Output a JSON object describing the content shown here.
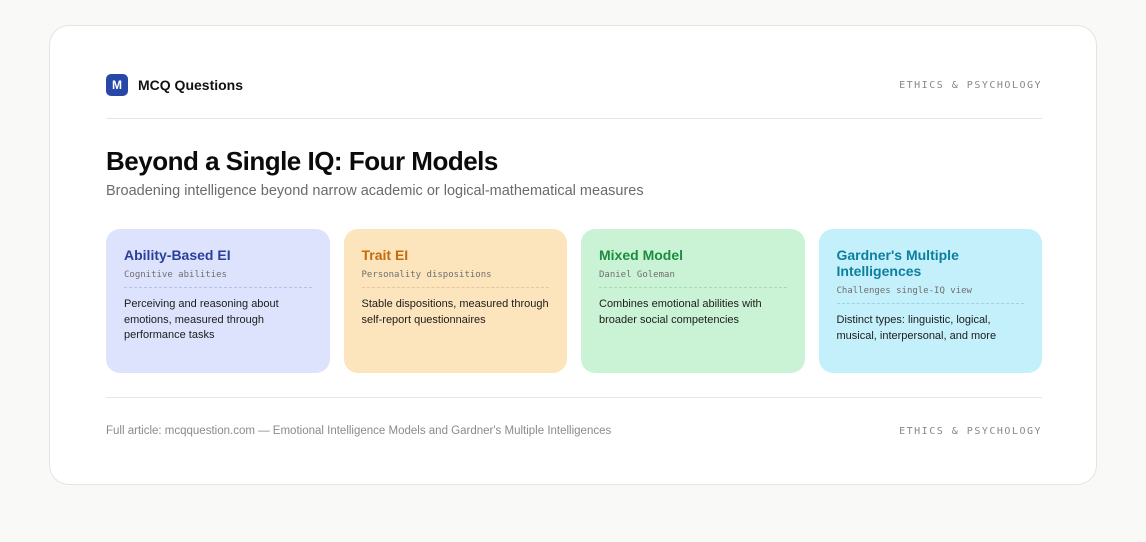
{
  "header": {
    "logo_letter": "M",
    "brand_name": "MCQ Questions",
    "category": "ETHICS & PSYCHOLOGY"
  },
  "page": {
    "title": "Beyond a Single IQ: Four Models",
    "subtitle": "Broadening intelligence beyond narrow academic or logical-mathematical measures"
  },
  "models": [
    {
      "name": "Ability-Based EI",
      "subtitle": "Cognitive abilities",
      "description": "Perceiving and reasoning about emotions, measured through performance tasks",
      "bg_color": "#dde3fc",
      "title_color": "#2a3f9a",
      "rule_color": "#b9c2e6"
    },
    {
      "name": "Trait EI",
      "subtitle": "Personality dispositions",
      "description": "Stable dispositions, measured through self-report questionnaires",
      "bg_color": "#fce4bc",
      "title_color": "#c66a0a",
      "rule_color": "#e5c89a"
    },
    {
      "name": "Mixed Model",
      "subtitle": "Daniel Goleman",
      "description": "Combines emotional abilities with broader social competencies",
      "bg_color": "#caf3d6",
      "title_color": "#1c8c3f",
      "rule_color": "#a6d9b4"
    },
    {
      "name": "Gardner's Multiple Intelligences",
      "subtitle": "Challenges single-IQ view",
      "description": "Distinct types: linguistic, logical, musical, interpersonal, and more",
      "bg_color": "#c3f0fb",
      "title_color": "#0d7f9e",
      "rule_color": "#9bd5e4"
    }
  ],
  "footer": {
    "text": "Full article: mcqquestion.com — Emotional Intelligence Models and Gardner's Multiple Intelligences",
    "category": "ETHICS & PSYCHOLOGY"
  }
}
